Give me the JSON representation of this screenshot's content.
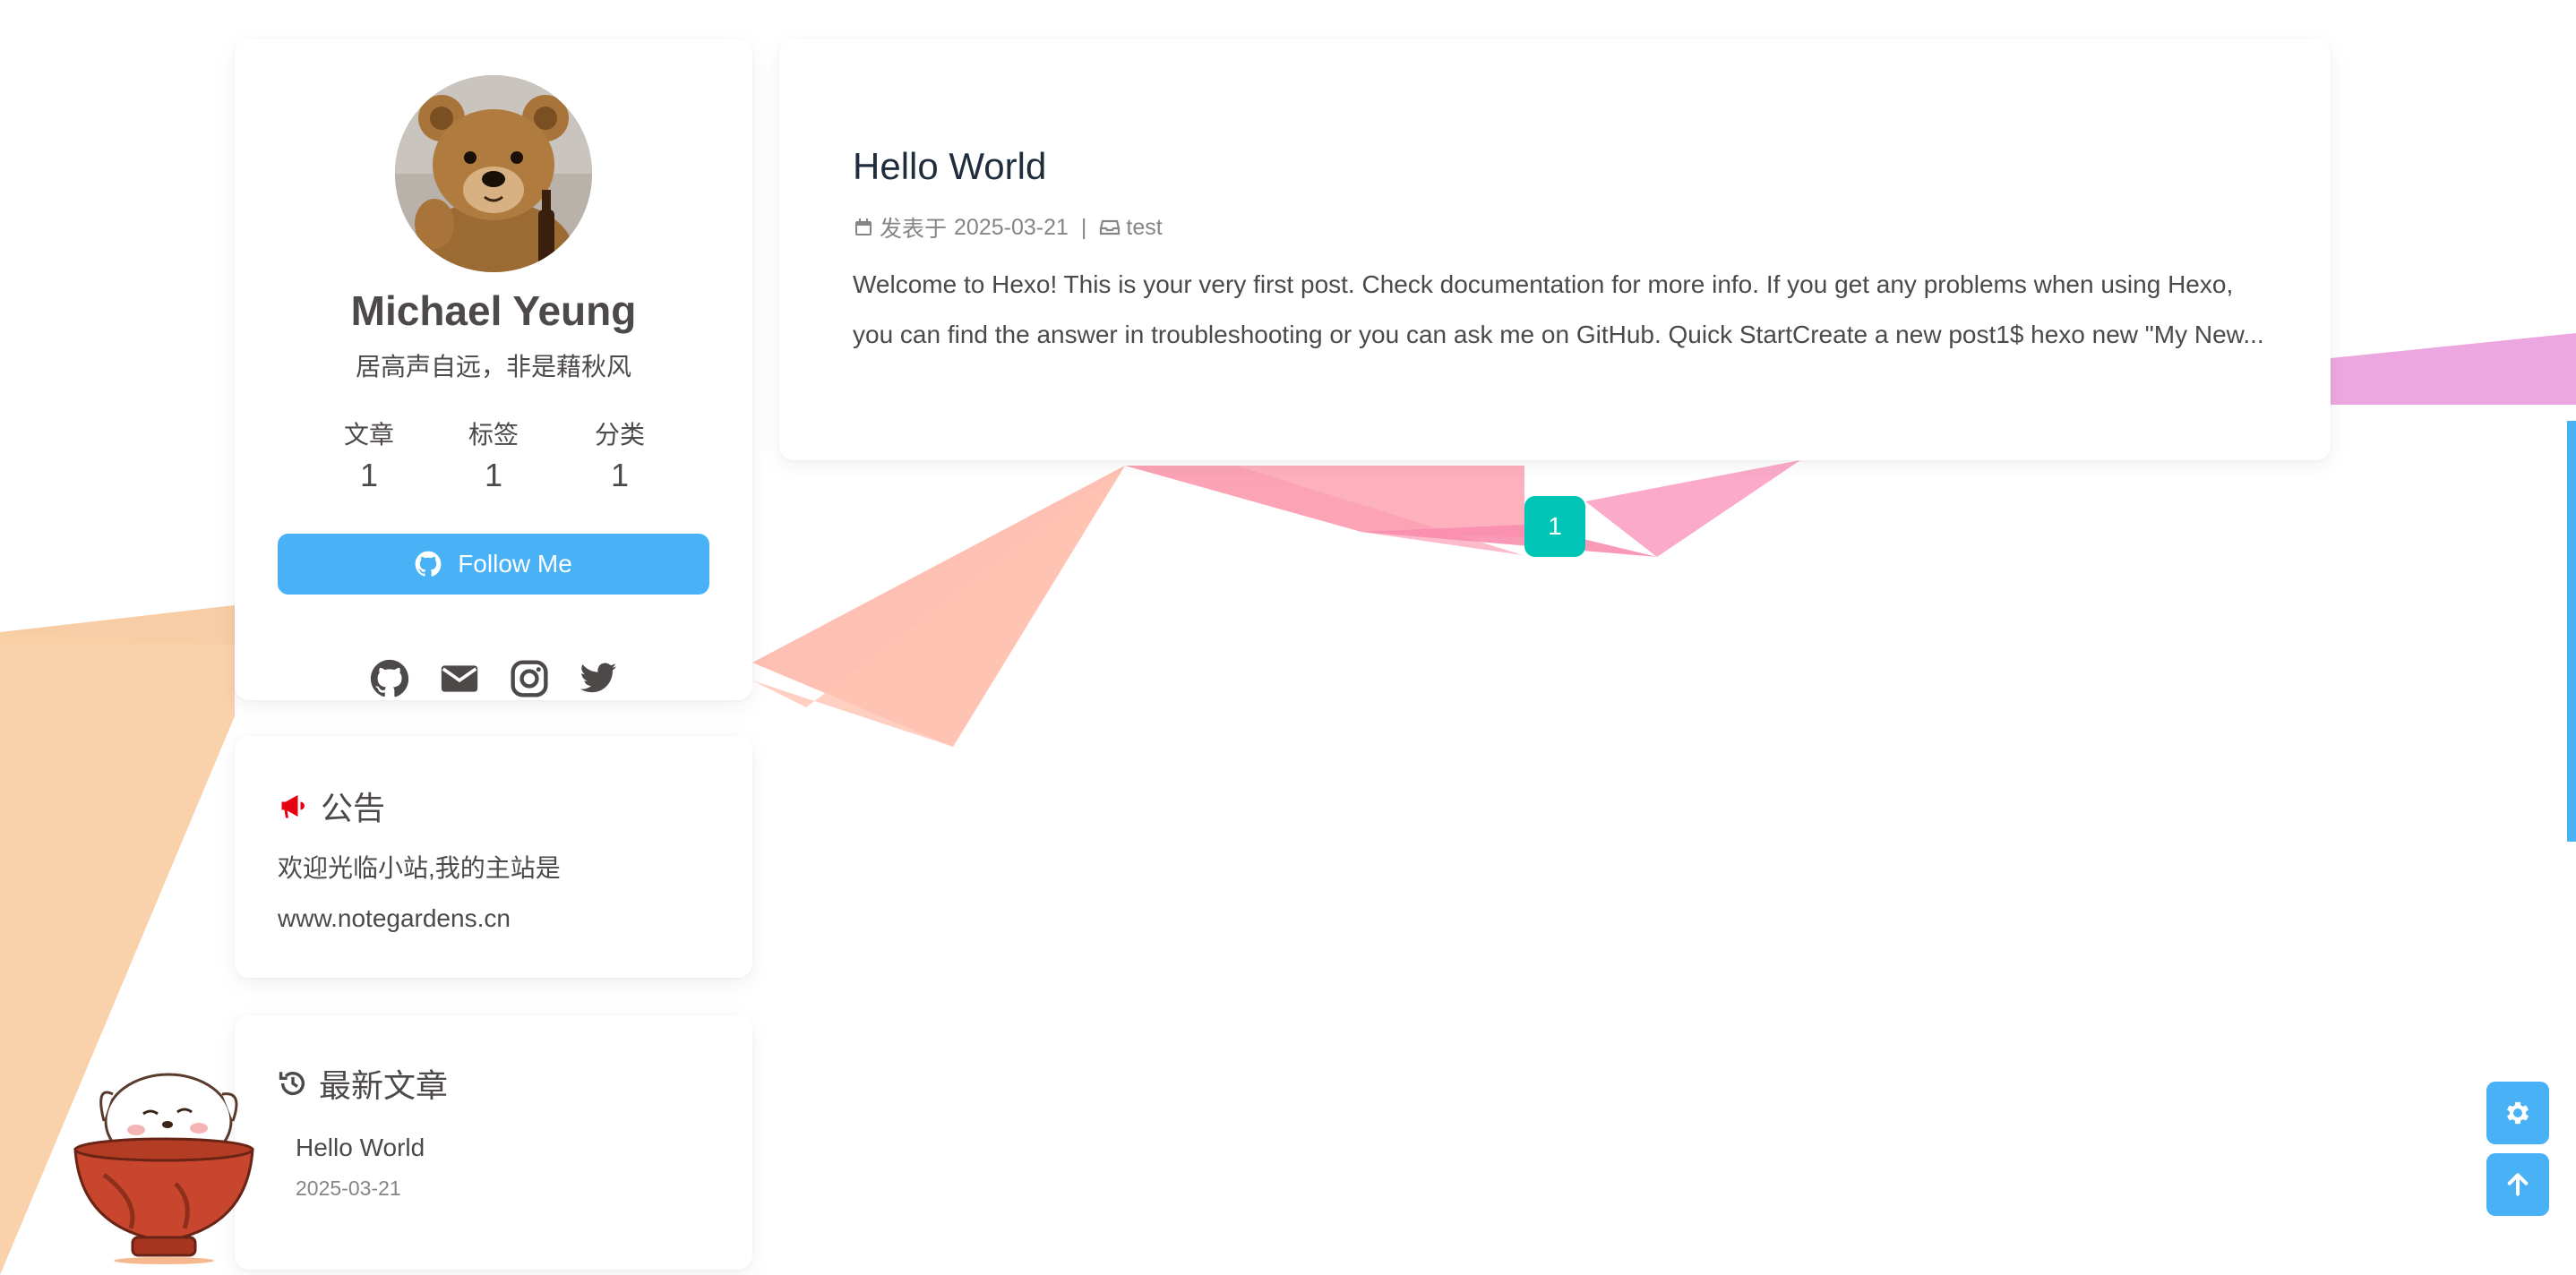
{
  "profile": {
    "name": "Michael Yeung",
    "description": "居高声自远，非是藉秋风",
    "stats": [
      {
        "label": "文章",
        "value": "1"
      },
      {
        "label": "标签",
        "value": "1"
      },
      {
        "label": "分类",
        "value": "1"
      }
    ],
    "follow_label": "Follow Me",
    "social_icons": [
      "github-icon",
      "envelope-icon",
      "instagram-icon",
      "twitter-icon"
    ]
  },
  "announcement": {
    "heading": "公告",
    "text_line1": "欢迎光临小站,我的主站是",
    "text_line2": "www.notegardens.cn"
  },
  "recent": {
    "heading": "最新文章",
    "items": [
      {
        "title": "Hello World",
        "date": "2025-03-21"
      }
    ]
  },
  "post": {
    "title": "Hello World",
    "date_prefix": "发表于",
    "date": "2025-03-21",
    "separator": "|",
    "category": "test",
    "excerpt": "Welcome to Hexo! This is your very first post. Check documentation for more info. If you get any problems when using Hexo, you can find the answer in troubleshooting or you can ask me on GitHub. Quick StartCreate a new post1$ hexo new \"My New..."
  },
  "pagination": {
    "current_page": "1"
  },
  "colors": {
    "accent": "#49b1f5",
    "pagination": "#00c4b6",
    "announcement_icon": "#e60012"
  }
}
